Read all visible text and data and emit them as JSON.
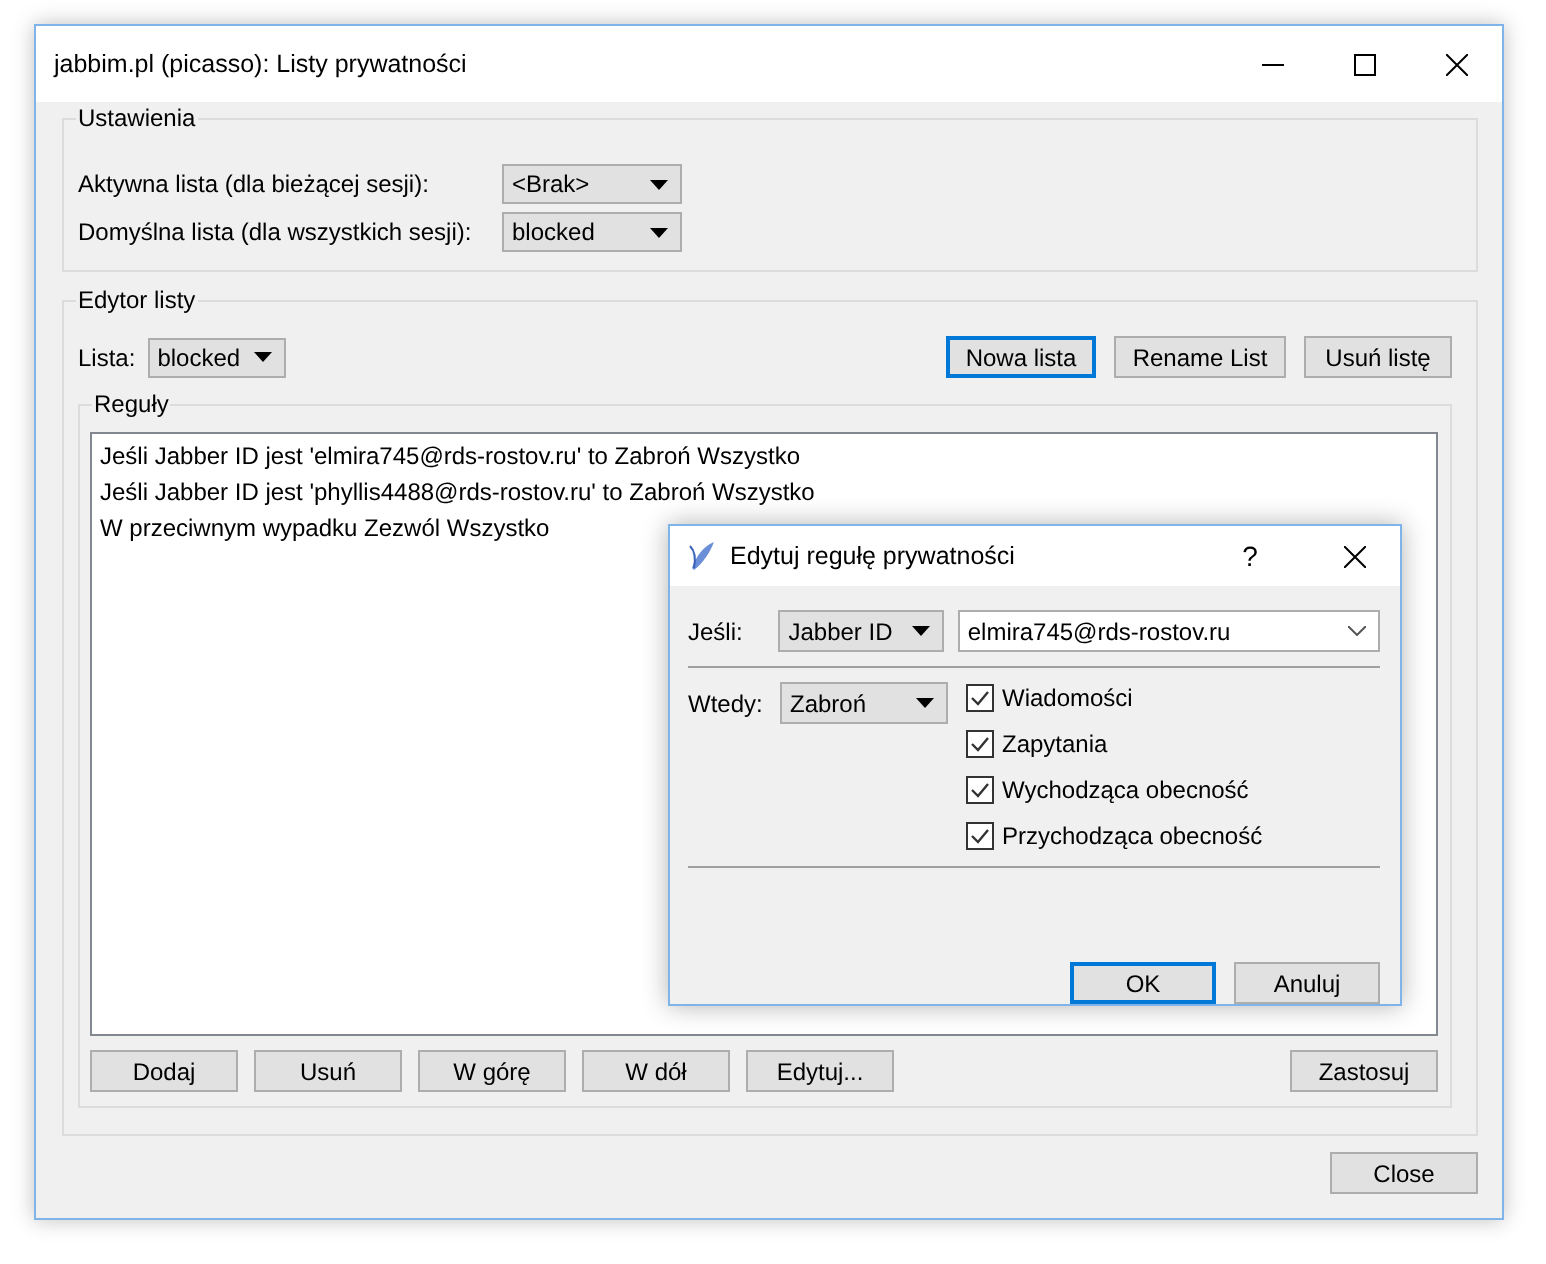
{
  "window": {
    "title": "jabbim.pl (picasso): Listy prywatności"
  },
  "settings": {
    "title": "Ustawienia",
    "rows": [
      {
        "label": "Aktywna lista (dla bieżącej sesji):",
        "value": "<Brak>"
      },
      {
        "label": "Domyślna lista (dla wszystkich sesji):",
        "value": "blocked"
      }
    ]
  },
  "editor": {
    "title": "Edytor listy",
    "list_label": "Lista:",
    "list_value": "blocked",
    "buttons": [
      {
        "label": "Nowa lista",
        "selected": true
      },
      {
        "label": "Rename List",
        "selected": false
      },
      {
        "label": "Usuń listę",
        "selected": false
      }
    ],
    "rules": {
      "title": "Reguły",
      "items": [
        "Jeśli Jabber ID jest 'elmira745@rds-rostov.ru' to Zabroń Wszystko",
        "Jeśli Jabber ID jest 'phyllis4488@rds-rostov.ru' to Zabroń Wszystko",
        "W przeciwnym wypadku Zezwól Wszystko"
      ],
      "buttons": [
        "Dodaj",
        "Usuń",
        "W górę",
        "W dół",
        "Edytuj..."
      ],
      "apply": "Zastosuj"
    }
  },
  "close_button": "Close",
  "dialog": {
    "title": "Edytuj regułę prywatności",
    "help": "?",
    "if_label": "Jeśli:",
    "if_type": "Jabber ID",
    "if_value": "elmira745@rds-rostov.ru",
    "then_label": "Wtedy:",
    "then_action": "Zabroń",
    "options": [
      {
        "label": "Wiadomości",
        "checked": true
      },
      {
        "label": "Zapytania",
        "checked": true
      },
      {
        "label": "Wychodząca obecność",
        "checked": true
      },
      {
        "label": "Przychodząca obecność",
        "checked": true
      }
    ],
    "buttons": [
      {
        "label": "OK",
        "selected": true
      },
      {
        "label": "Anuluj",
        "selected": false
      }
    ]
  }
}
